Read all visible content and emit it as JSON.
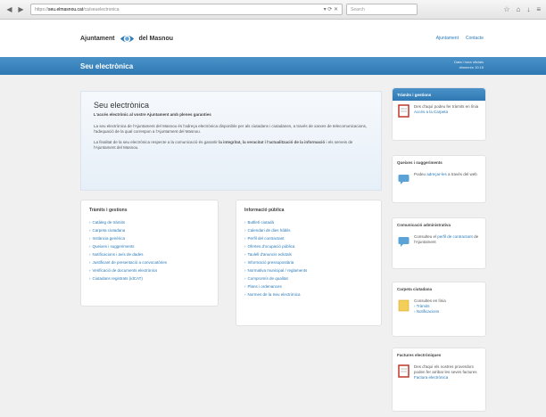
{
  "browser": {
    "back": "◀",
    "forward": "▶",
    "url_proto": "https://",
    "url_host": "seu.elmasnou.cat",
    "url_path": "/ca/seuelectronica",
    "search_placeholder": "Search",
    "icons": [
      "star-icon",
      "home-icon",
      "download-icon",
      "menu-icon"
    ]
  },
  "header": {
    "logo_left": "Ajuntament",
    "logo_right": "del Masnou",
    "links": [
      "Ajuntament",
      "Contacte"
    ]
  },
  "sede_bar": {
    "title": "Seu electrònica",
    "date_line1": "Data i hora oficials",
    "date_line2": "dimecres 10:18"
  },
  "intro": {
    "title": "Seu electrònica",
    "subtitle": "L'accés electrònic al vostre Ajuntament amb plenes garanties",
    "para1": "La seu electrònica de l'Ajuntament del Masnou és l'adreça electrònica disponible per als ciutadans i ciutadanes, a través de xarxes de telecomunicacions, l'adequació de la qual correspon a l'Ajuntament del Masnou.",
    "para2_a": "La finalitat de la seu electrònica respecte a la comunicació és garantir ",
    "para2_b": "la integritat, la veracitat i l'actualització de la informació",
    "para2_c": " i els serveis de l'Ajuntament del Masnou."
  },
  "tramits": {
    "title": "Tràmits i gestions",
    "items": [
      "Catàleg de tràmits",
      "Carpeta ciutadana",
      "Instància genèrica",
      "Queixes i suggeriments",
      "Notificacions i avís de dades",
      "Justificant de presentació a convocatòries",
      "Verificació de documents electrònics",
      "Ciutadans registrats (idCAT)"
    ]
  },
  "info": {
    "title": "Informació pública",
    "items": [
      "Butlletí ciutadà",
      "Calendari de dies hàbils",
      "Perfil del contractant",
      "Ofertes d'ocupació pública",
      "Taulell d'anuncis edictals",
      "Informació pressupostària",
      "Normativa municipal / reglaments",
      "Compromís de qualitat",
      "Plans i ordenances",
      "Normes de la Seu electrònica"
    ]
  },
  "side": {
    "s1": {
      "title": "Tràmits i gestions",
      "text": "Des d'aquí podeu fer tràmits en línia",
      "link": "Accés a la Carpeta"
    },
    "s2": {
      "title": "Queixes i suggeriments",
      "text_a": "Podeu ",
      "link": "adreçar-les",
      "text_b": " a través del web"
    },
    "s3": {
      "title": "Comunicació administrativa",
      "text_a": "Consulteu el ",
      "link": "perfil de contractant",
      "text_b": " de l'Ajuntament"
    },
    "s4": {
      "title": "Carpeta ciutadana",
      "text": "Consultes en línia",
      "links": [
        "Tràmits",
        "Notificacions"
      ]
    },
    "s5": {
      "title": "Factures electròniques",
      "text": "Des d'aquí els nostres proveïdors poden fer arribar les seves factures",
      "link": "Factura electrònica"
    }
  },
  "colors": {
    "accent": "#2e78b3",
    "link": "#2a7ab8"
  }
}
